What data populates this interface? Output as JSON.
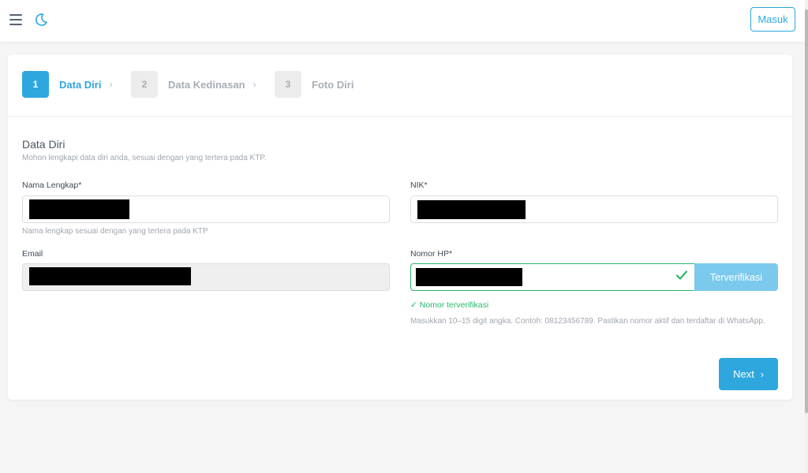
{
  "header": {
    "login_label": "Masuk",
    "icons": [
      "hamburger-menu-icon",
      "moon-icon"
    ]
  },
  "steps": [
    {
      "number": "1",
      "label": "Data Diri",
      "active": true
    },
    {
      "number": "2",
      "label": "Data Kedinasan",
      "active": false
    },
    {
      "number": "3",
      "label": "Foto Diri",
      "active": false
    }
  ],
  "form": {
    "title": "Data Diri",
    "subtitle": "Mohon lengkapi data diri anda, sesuai dengan yang tertera pada KTP.",
    "full_name": {
      "label": "Nama Lengkap*",
      "value": "",
      "hint": "Nama lengkap sesuai dengan yang tertera pada KTP"
    },
    "nik": {
      "label": "NIK*",
      "value": ""
    },
    "email": {
      "label": "Email",
      "value": ""
    },
    "phone": {
      "label": "Nomor HP*",
      "value": "",
      "verify_label": "Terverifikasi",
      "verified_text": "✓ Nomor terverifikasi",
      "hint": "Masukkan 10–15 digit angka. Contoh: 08123456789. Pastikan nomor aktif dan terdaftar di WhatsApp."
    },
    "next_label": "Next",
    "next_chevron": "›"
  },
  "step_chevron": "›",
  "colors": {
    "accent": "#2ea7de",
    "success": "#28b86b",
    "muted": "#a7aeb6"
  }
}
